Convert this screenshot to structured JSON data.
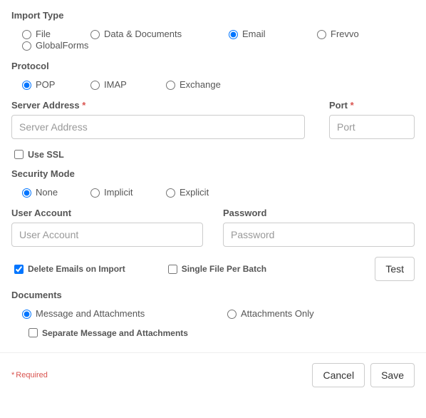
{
  "importType": {
    "label": "Import Type",
    "options": [
      "File",
      "Data & Documents",
      "Email",
      "Frevvo",
      "GlobalForms"
    ],
    "selected": "Email"
  },
  "protocol": {
    "label": "Protocol",
    "options": [
      "POP",
      "IMAP",
      "Exchange"
    ],
    "selected": "POP"
  },
  "serverAddress": {
    "label": "Server Address",
    "placeholder": "Server Address",
    "value": "",
    "required": true
  },
  "port": {
    "label": "Port",
    "placeholder": "Port",
    "value": "",
    "required": true
  },
  "useSSL": {
    "label": "Use SSL",
    "checked": false
  },
  "securityMode": {
    "label": "Security Mode",
    "options": [
      "None",
      "Implicit",
      "Explicit"
    ],
    "selected": "None"
  },
  "userAccount": {
    "label": "User Account",
    "placeholder": "User Account",
    "value": ""
  },
  "password": {
    "label": "Password",
    "placeholder": "Password",
    "value": ""
  },
  "deleteEmails": {
    "label": "Delete Emails on Import",
    "checked": true
  },
  "singleFile": {
    "label": "Single File Per Batch",
    "checked": false
  },
  "testButton": "Test",
  "documents": {
    "label": "Documents",
    "options": [
      "Message and Attachments",
      "Attachments Only"
    ],
    "selected": "Message and Attachments"
  },
  "separateMsg": {
    "label": "Separate Message and Attachments",
    "checked": false
  },
  "requiredNote": "Required",
  "footer": {
    "cancel": "Cancel",
    "save": "Save"
  }
}
